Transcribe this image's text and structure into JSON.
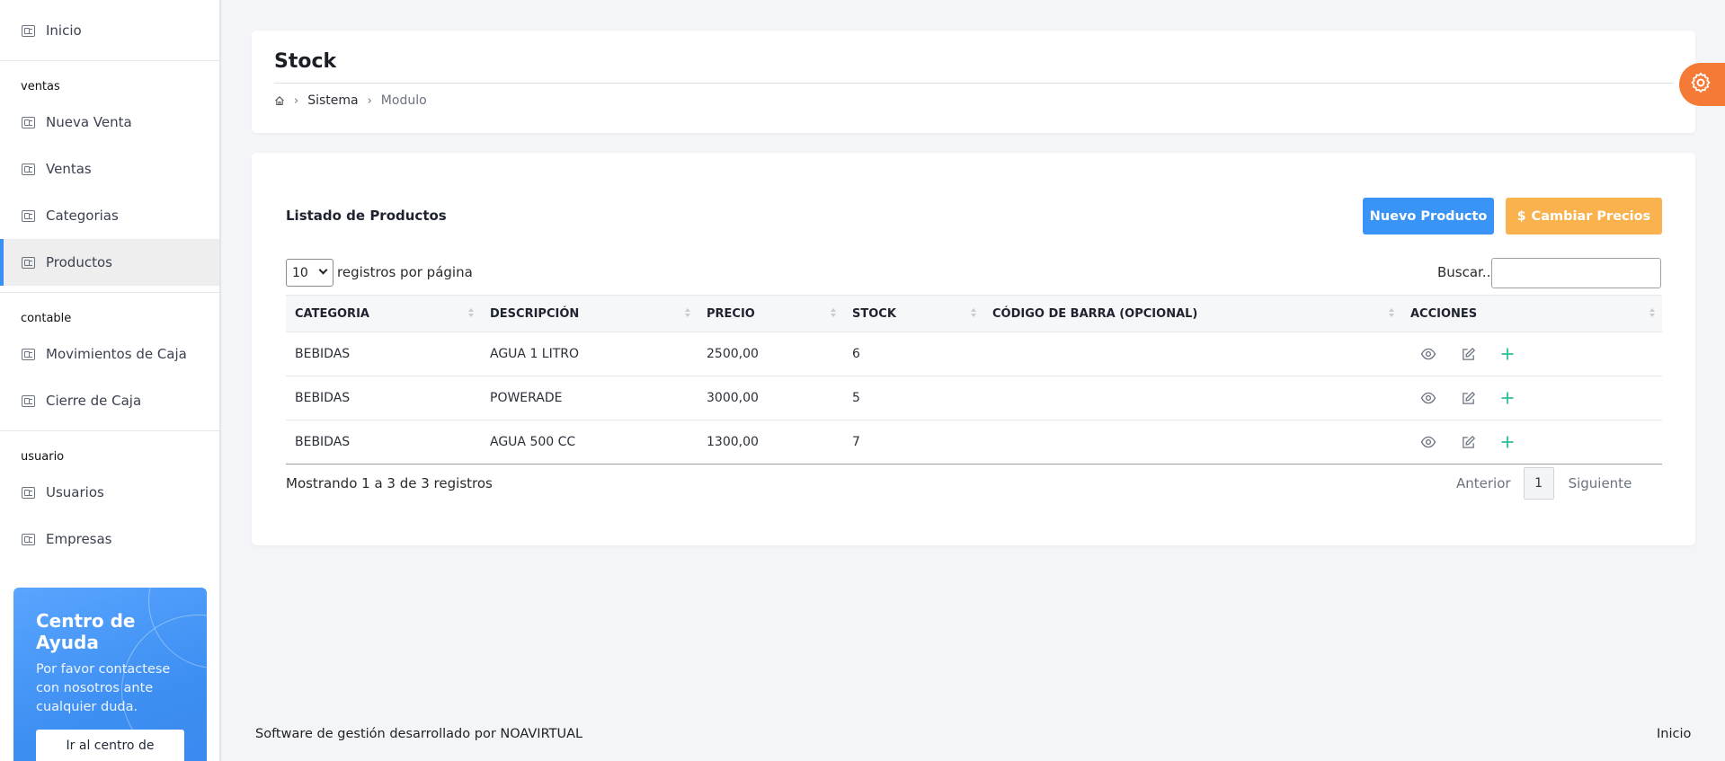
{
  "sidebar": {
    "top_item": "Inicio",
    "sections": [
      {
        "title": "ventas",
        "items": [
          "Nueva Venta",
          "Ventas",
          "Categorias",
          "Productos"
        ]
      },
      {
        "title": "contable",
        "items": [
          "Movimientos de Caja",
          "Cierre de Caja"
        ]
      },
      {
        "title": "usuario",
        "items": [
          "Usuarios",
          "Empresas"
        ]
      }
    ],
    "active_item": "Productos",
    "help": {
      "title": "Centro de Ayuda",
      "text": "Por favor contactese con nosotros ante cualquier duda.",
      "button": "Ir al centro de"
    }
  },
  "header": {
    "title": "Stock",
    "breadcrumb": [
      "Sistema",
      "Modulo"
    ],
    "icons": [
      "home-icon",
      "gear-icon"
    ]
  },
  "main": {
    "list_title": "Listado de Productos",
    "new_button": "Nuevo Producto",
    "prices_button": "Cambiar Precios",
    "prices_icon": "$",
    "page_length": "10",
    "page_length_label": "registros por página",
    "search_label": "Buscar...",
    "search_value": "",
    "columns": [
      "CATEGORIA",
      "DESCRIPCIÓN",
      "PRECIO",
      "STOCK",
      "CÓDIGO DE BARRA (OPCIONAL)",
      "ACCIONES"
    ],
    "rows": [
      {
        "categoria": "BEBIDAS",
        "descripcion": "AGUA 1 LITRO",
        "precio": "2500,00",
        "stock": "6",
        "codigo": ""
      },
      {
        "categoria": "BEBIDAS",
        "descripcion": "POWERADE",
        "precio": "3000,00",
        "stock": "5",
        "codigo": ""
      },
      {
        "categoria": "BEBIDAS",
        "descripcion": "AGUA 500 CC",
        "precio": "1300,00",
        "stock": "7",
        "codigo": ""
      }
    ],
    "row_actions": [
      "eye-icon",
      "edit-icon",
      "plus-icon"
    ],
    "info": "Mostrando 1 a 3 de 3 registros",
    "pager": {
      "prev": "Anterior",
      "current": "1",
      "next": "Siguiente"
    }
  },
  "footer": {
    "left": "Software de gestión desarrollado por NOAVIRTUAL",
    "right": "Inicio"
  },
  "colors": {
    "primary": "#3a94f5",
    "warning": "#f9b24e",
    "gear": "#f57a35",
    "action_plus": "#2bbf9a"
  }
}
